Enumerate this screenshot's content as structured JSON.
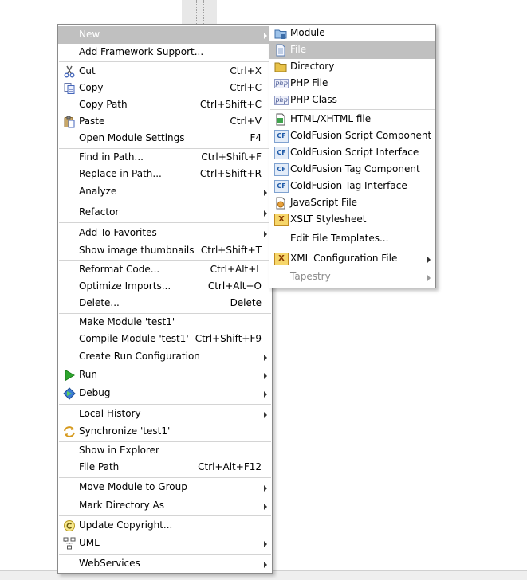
{
  "main_menu": {
    "new": "New",
    "add_framework": "Add Framework Support...",
    "cut": "Cut",
    "cut_sc": "Ctrl+X",
    "copy": "Copy",
    "copy_sc": "Ctrl+C",
    "copy_path": "Copy Path",
    "copy_path_sc": "Ctrl+Shift+C",
    "paste": "Paste",
    "paste_sc": "Ctrl+V",
    "open_module_settings": "Open Module Settings",
    "open_module_settings_sc": "F4",
    "find_in_path": "Find in Path...",
    "find_in_path_sc": "Ctrl+Shift+F",
    "replace_in_path": "Replace in Path...",
    "replace_in_path_sc": "Ctrl+Shift+R",
    "analyze": "Analyze",
    "refactor": "Refactor",
    "add_to_favorites": "Add To Favorites",
    "show_thumbnails": "Show image thumbnails",
    "show_thumbnails_sc": "Ctrl+Shift+T",
    "reformat_code": "Reformat Code...",
    "reformat_code_sc": "Ctrl+Alt+L",
    "optimize_imports": "Optimize Imports...",
    "optimize_imports_sc": "Ctrl+Alt+O",
    "delete": "Delete...",
    "delete_sc": "Delete",
    "make_module": "Make Module 'test1'",
    "compile_module": "Compile Module 'test1'",
    "compile_module_sc": "Ctrl+Shift+F9",
    "create_run_config": "Create Run Configuration",
    "run": "Run",
    "debug": "Debug",
    "local_history": "Local History",
    "synchronize": "Synchronize 'test1'",
    "show_in_explorer": "Show in Explorer",
    "file_path": "File Path",
    "file_path_sc": "Ctrl+Alt+F12",
    "move_module": "Move Module to Group",
    "mark_directory": "Mark Directory As",
    "update_copyright": "Update Copyright...",
    "uml": "UML",
    "webservices": "WebServices"
  },
  "sub_menu": {
    "module": "Module",
    "file": "File",
    "directory": "Directory",
    "php_file": "PHP File",
    "php_class": "PHP Class",
    "html_file": "HTML/XHTML file",
    "cf_script_component": "ColdFusion Script Component",
    "cf_script_interface": "ColdFusion Script Interface",
    "cf_tag_component": "ColdFusion Tag Component",
    "cf_tag_interface": "ColdFusion Tag Interface",
    "javascript_file": "JavaScript File",
    "xslt_stylesheet": "XSLT Stylesheet",
    "edit_templates": "Edit File Templates...",
    "xml_config": "XML Configuration File",
    "tapestry": "Tapestry"
  },
  "icons": {
    "php_text": "php",
    "cf_text": "CF",
    "xsl_text": "X"
  },
  "colors": {
    "selection": "#c0c0c0",
    "menu_border": "#8a8a8a",
    "run_green": "#2ea62e",
    "folder_yellow": "#e8c24a"
  }
}
